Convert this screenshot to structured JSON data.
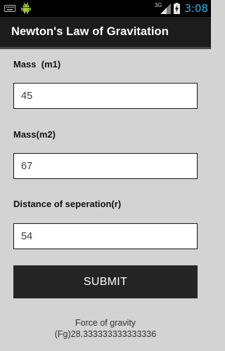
{
  "status_bar": {
    "network_type": "3G",
    "time": "3:08",
    "icons": [
      "keyboard-icon",
      "android-icon",
      "signal-icon",
      "battery-charging-icon"
    ],
    "clock_color": "#33b5e5"
  },
  "app": {
    "title": "Newton's Law of Gravitation"
  },
  "form": {
    "mass1": {
      "label": "Mass  (m1)",
      "value": "45"
    },
    "mass2": {
      "label": "Mass(m2)",
      "value": "67"
    },
    "distance": {
      "label": "Distance of seperation(r)",
      "value": "54"
    },
    "submit_label": "SUBMIT"
  },
  "result": {
    "line1": "Force of gravity",
    "line2": "(Fg)28.333333333333336"
  }
}
